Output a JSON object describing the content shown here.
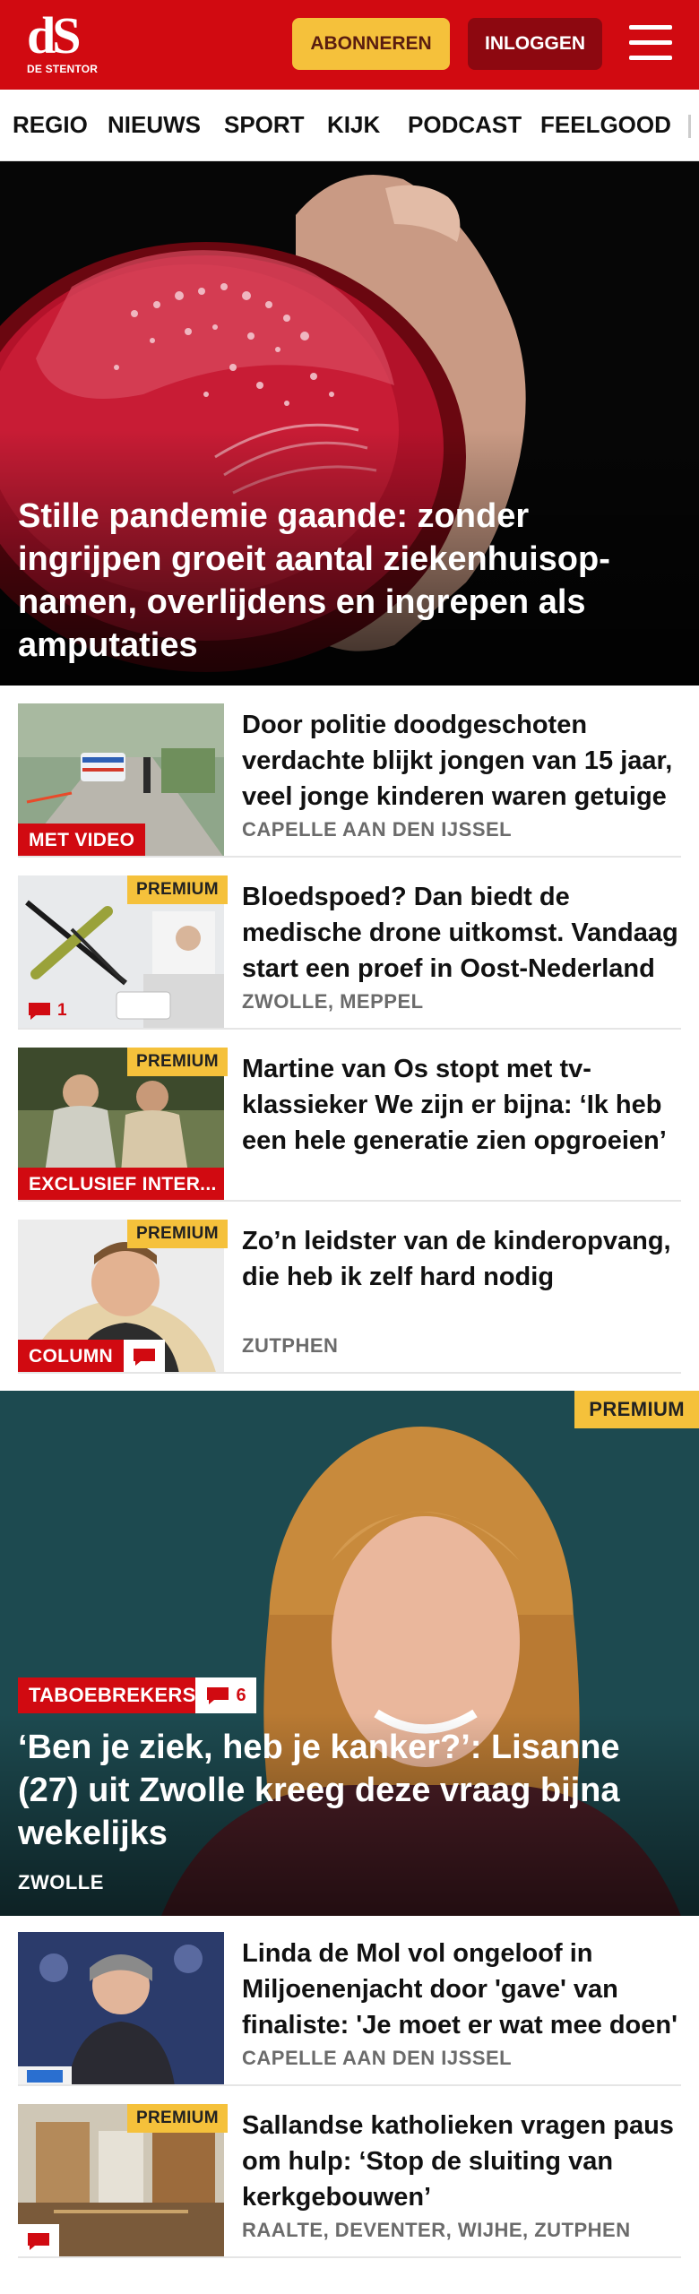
{
  "header": {
    "logo_text": "dS",
    "logo_sub": "DE STENTOR",
    "subscribe_label": "ABONNEREN",
    "login_label": "INLOGGEN"
  },
  "nav": {
    "items": [
      "REGIO",
      "NIEUWS",
      "SPORT",
      "KIJK",
      "PODCAST",
      "FEELGOOD"
    ]
  },
  "hero": {
    "title": "Stille pandemie gaande: zonder ingrijpen groeit aantal ziekenhuisop­namen, overlijdens en ingrepen als amputaties"
  },
  "articles": [
    {
      "title": "Door politie doodgeschoten verdachte blijkt jongen van 15 jaar, veel jonge kinderen waren getuige",
      "location": "CAPELLE AAN DEN IJSSEL",
      "label": "MET VIDEO"
    },
    {
      "title": "Bloedspoed? Dan biedt de medische drone uitkomst. Vandaag start een proef in Oost-Nederland",
      "location": "ZWOLLE, MEPPEL",
      "premium": "PREMIUM",
      "comments": "1"
    },
    {
      "title": "Martine van Os stopt met tv-klassieker We zijn er bijna: ‘Ik heb een hele generatie zien opgroeien’",
      "location": "",
      "premium": "PREMIUM",
      "label": "EXCLUSIEF INTER..."
    },
    {
      "title": "Zo’n leidster van de kinderop­vang, die heb ik zelf hard nodig",
      "location": "ZUTPHEN",
      "premium": "PREMIUM",
      "label": "COLUMN"
    }
  ],
  "feature": {
    "premium": "PREMIUM",
    "tag": "TABOEBREKERS",
    "comments": "6",
    "title": "‘Ben je ziek, heb je kanker?’: Lisanne (27) uit Zwolle kreeg deze vraag bijna wekelijks",
    "location": "ZWOLLE"
  },
  "articles2": [
    {
      "title": "Linda de Mol vol ongeloof in Miljoenenjacht door 'gave' van finaliste: 'Je moet er wat mee doen'",
      "location": "CAPELLE AAN DEN IJSSEL"
    },
    {
      "title": "Sallandse katholieken vragen paus om hulp: ‘Stop de sluiting van kerkgebouwen’",
      "location": "RAALTE, DEVENTER, WIJHE, ZUTPHEN",
      "premium": "PREMIUM"
    }
  ],
  "colors": {
    "brand_red": "#d10a11",
    "premium_yellow": "#f5c13b",
    "login_dark_red": "#8d0810"
  }
}
